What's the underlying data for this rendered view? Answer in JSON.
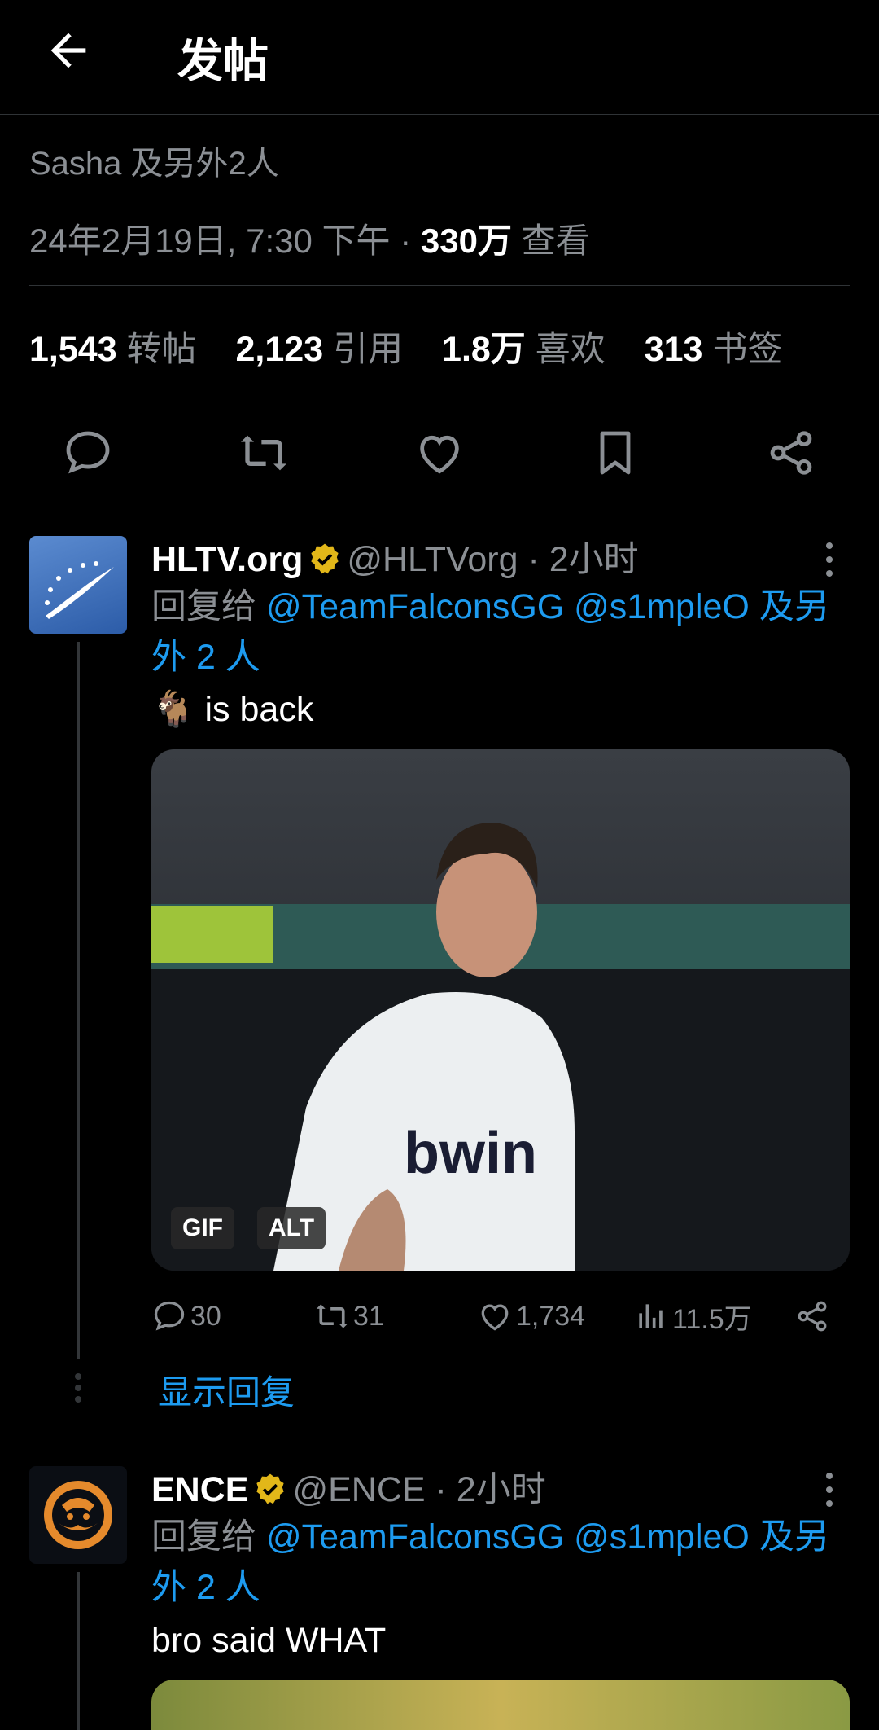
{
  "header": {
    "title": "发帖"
  },
  "post": {
    "reposted_by": "Sasha 及另外2人",
    "timestamp": "24年2月19日, 7:30 下午 · ",
    "views_count": "330万",
    "views_label": " 查看",
    "stats": [
      {
        "num": "1,543",
        "label": "转帖"
      },
      {
        "num": "2,123",
        "label": "引用"
      },
      {
        "num": "1.8万",
        "label": "喜欢"
      },
      {
        "num": "313",
        "label": "书签"
      }
    ]
  },
  "replies": [
    {
      "name": "HLTV.org",
      "handle": "@HLTVorg · 2小时",
      "replying_prefix": "回复给 ",
      "replying_targets": "@TeamFalconsGG @s1mpleO 及另外 2 人",
      "text": "🐐 is back",
      "media_badges": [
        "GIF",
        "ALT"
      ],
      "actions": {
        "replies": "30",
        "retweets": "31",
        "likes": "1,734",
        "views": "11.5万"
      },
      "show_replies": "显示回复"
    },
    {
      "name": "ENCE",
      "handle": "@ENCE · 2小时",
      "replying_prefix": "回复给 ",
      "replying_targets": "@TeamFalconsGG @s1mpleO 及另外 2 人",
      "text": "bro said WHAT"
    }
  ],
  "colors": {
    "background": "#000000",
    "accent": "#1d9bf0",
    "verified": "#e2b719",
    "muted": "#8b8f94"
  }
}
